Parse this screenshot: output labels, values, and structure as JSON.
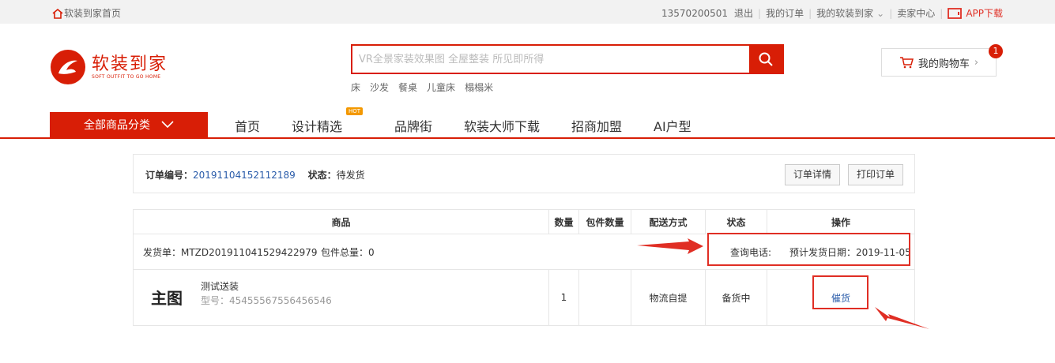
{
  "topbar": {
    "home": "软装到家首页",
    "phone": "13570200501",
    "logout": "退出",
    "my_orders": "我的订单",
    "my_home": "我的软装到家",
    "seller": "卖家中心",
    "app": "APP下载"
  },
  "logo": {
    "cn": "软装到家",
    "en": "SOFT OUTFIT TO GO HOME"
  },
  "search": {
    "placeholder": "VR全景家装效果图 全屋整装 所见即所得"
  },
  "hotwords": [
    "床",
    "沙发",
    "餐桌",
    "儿童床",
    "榻榻米"
  ],
  "cart": {
    "label": "我的购物车",
    "count": "1"
  },
  "nav": {
    "category": "全部商品分类",
    "items": [
      "首页",
      "设计精选",
      "品牌街",
      "软装大师下载",
      "招商加盟",
      "AI户型"
    ],
    "hot": "HOT"
  },
  "order": {
    "no_label": "订单编号：",
    "no_value": "20191104152112189",
    "status_label": "状态：",
    "status_value": "待发货",
    "detail_btn": "订单详情",
    "print_btn": "打印订单"
  },
  "table": {
    "headers": [
      "商品",
      "数量",
      "包件数量",
      "配送方式",
      "状态",
      "操作"
    ],
    "shipment": {
      "label": "发货单：MTZD201911041529422979",
      "total": "包件总量：0",
      "phone": "查询电话:",
      "date": "预计发货日期：2019-11-05"
    },
    "item": {
      "thumb": "主图",
      "name": "测试送装",
      "model": "型号：454555675564565​46",
      "qty": "1",
      "pkg": "",
      "delivery": "物流自提",
      "status": "备货中",
      "action": "催货"
    }
  },
  "colors": {
    "brand": "#d81e06",
    "link": "#2a5caa"
  }
}
